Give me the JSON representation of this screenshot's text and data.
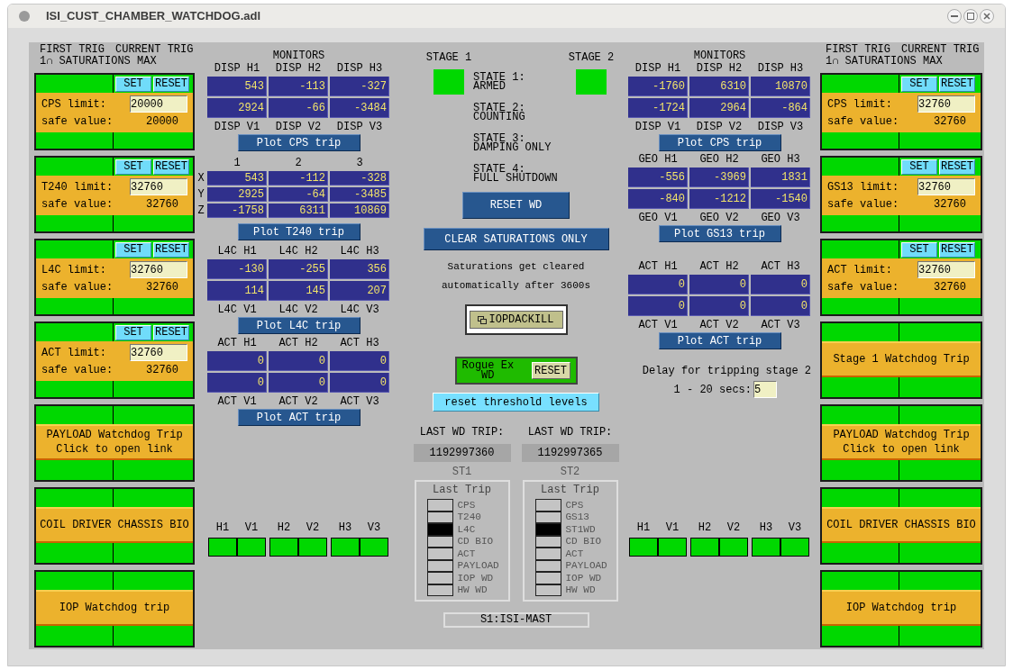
{
  "window": {
    "title": "ISI_CUST_CHAMBER_WATCHDOG.adl"
  },
  "left_column": {
    "header": [
      "FIRST TRIG",
      "CURRENT TRIG"
    ],
    "subheader": "1∩ SATURATIONS MAX",
    "cards": [
      {
        "kind": "limit",
        "label": "CPS limit:",
        "value": "20000",
        "safe_label": "safe value:",
        "safe_value": "20000",
        "set": "SET",
        "reset": "RESET"
      },
      {
        "kind": "limit",
        "label": "T240 limit:",
        "value": "32760",
        "safe_label": "safe value:",
        "safe_value": "32760",
        "set": "SET",
        "reset": "RESET"
      },
      {
        "kind": "limit",
        "label": "L4C limit:",
        "value": "32760",
        "safe_label": "safe value:",
        "safe_value": "32760",
        "set": "SET",
        "reset": "RESET"
      },
      {
        "kind": "limit",
        "label": "ACT limit:",
        "value": "32760",
        "safe_label": "safe value:",
        "safe_value": "32760",
        "set": "SET",
        "reset": "RESET"
      },
      {
        "kind": "trip",
        "lines": [
          "PAYLOAD Watchdog Trip",
          "Click to open link"
        ]
      },
      {
        "kind": "trip",
        "lines": [
          "COIL DRIVER CHASSIS BIO"
        ]
      },
      {
        "kind": "trip",
        "lines": [
          "IOP Watchdog trip"
        ]
      }
    ]
  },
  "left_monitors": {
    "title": "MONITORS",
    "groups": [
      {
        "kind": "pair",
        "top_labels": [
          "DISP H1",
          "DISP H2",
          "DISP H3"
        ],
        "rows": [
          [
            "543",
            "-113",
            "-327"
          ],
          [
            "2924",
            "-66",
            "-3484"
          ]
        ],
        "bottom_labels": [
          "DISP V1",
          "DISP V2",
          "DISP V3"
        ],
        "button": "Plot CPS trip"
      },
      {
        "kind": "matrix",
        "top_labels": [
          "1",
          "2",
          "3"
        ],
        "row_labels": [
          "X",
          "Y",
          "Z"
        ],
        "rows": [
          [
            "543",
            "-112",
            "-328"
          ],
          [
            "2925",
            "-64",
            "-3485"
          ],
          [
            "-1758",
            "6311",
            "10869"
          ]
        ],
        "button": "Plot T240 trip"
      },
      {
        "kind": "pair",
        "top_labels": [
          "L4C H1",
          "L4C H2",
          "L4C H3"
        ],
        "rows": [
          [
            "-130",
            "-255",
            "356"
          ],
          [
            "114",
            "145",
            "207"
          ]
        ],
        "bottom_labels": [
          "L4C V1",
          "L4C V2",
          "L4C V3"
        ],
        "button": "Plot L4C trip"
      },
      {
        "kind": "pair",
        "top_labels": [
          "ACT H1",
          "ACT H2",
          "ACT H3"
        ],
        "rows": [
          [
            "0",
            "0",
            "0"
          ],
          [
            "0",
            "0",
            "0"
          ]
        ],
        "bottom_labels": [
          "ACT V1",
          "ACT V2",
          "ACT V3"
        ],
        "button": "Plot ACT trip"
      }
    ],
    "indicators": [
      "H1",
      "V1",
      "H2",
      "V2",
      "H3",
      "V3"
    ]
  },
  "center": {
    "stages": [
      "STAGE 1",
      "STAGE 2"
    ],
    "states": [
      {
        "title": "STATE 1:",
        "name": "ARMED"
      },
      {
        "title": "STATE 2:",
        "name": "COUNTING"
      },
      {
        "title": "STATE 3:",
        "name": "DAMPING ONLY"
      },
      {
        "title": "STATE 4:",
        "name": "FULL SHUTDOWN"
      }
    ],
    "reset_wd": "RESET WD",
    "clear_saturations": "CLEAR SATURATIONS ONLY",
    "note": [
      "Saturations get cleared",
      "automatically after 3600s"
    ],
    "iopdackill": "IOPDACKILL",
    "rogue": {
      "label": [
        "Rogue Ex",
        "WD"
      ],
      "button": "RESET"
    },
    "reset_thresholds": "reset threshold levels",
    "last_trips": [
      {
        "label": "LAST WD TRIP:",
        "value": "1192997360",
        "stage": "ST1",
        "title": "Last Trip",
        "items": [
          {
            "label": "CPS",
            "selected": false
          },
          {
            "label": "T240",
            "selected": false
          },
          {
            "label": "L4C",
            "selected": true
          },
          {
            "label": "CD BIO",
            "selected": false
          },
          {
            "label": "ACT",
            "selected": false
          },
          {
            "label": "PAYLOAD",
            "selected": false
          },
          {
            "label": "IOP WD",
            "selected": false
          },
          {
            "label": "HW WD",
            "selected": false
          }
        ]
      },
      {
        "label": "LAST WD TRIP:",
        "value": "1192997365",
        "stage": "ST2",
        "title": "Last Trip",
        "items": [
          {
            "label": "CPS",
            "selected": false
          },
          {
            "label": "GS13",
            "selected": false
          },
          {
            "label": "ST1WD",
            "selected": true
          },
          {
            "label": "CD BIO",
            "selected": false
          },
          {
            "label": "ACT",
            "selected": false
          },
          {
            "label": "PAYLOAD",
            "selected": false
          },
          {
            "label": "IOP WD",
            "selected": false
          },
          {
            "label": "HW WD",
            "selected": false
          }
        ]
      }
    ],
    "footer": "S1:ISI-MAST"
  },
  "right_monitors": {
    "title": "MONITORS",
    "groups": [
      {
        "kind": "pair",
        "top_labels": [
          "DISP H1",
          "DISP H2",
          "DISP H3"
        ],
        "rows": [
          [
            "-1760",
            "6310",
            "10870"
          ],
          [
            "-1724",
            "2964",
            "-864"
          ]
        ],
        "bottom_labels": [
          "DISP V1",
          "DISP V2",
          "DISP V3"
        ],
        "button": "Plot CPS trip"
      },
      {
        "kind": "pair",
        "top_labels": [
          "GEO H1",
          "GEO H2",
          "GEO H3"
        ],
        "rows": [
          [
            "-556",
            "-3969",
            "1831"
          ],
          [
            "-840",
            "-1212",
            "-1540"
          ]
        ],
        "bottom_labels": [
          "GEO V1",
          "GEO V2",
          "GEO V3"
        ],
        "button": "Plot GS13 trip"
      },
      {
        "kind": "pair",
        "top_labels": [
          "ACT H1",
          "ACT H2",
          "ACT H3"
        ],
        "rows": [
          [
            "0",
            "0",
            "0"
          ],
          [
            "0",
            "0",
            "0"
          ]
        ],
        "bottom_labels": [
          "ACT V1",
          "ACT V2",
          "ACT V3"
        ],
        "button": "Plot ACT trip"
      }
    ],
    "delay": {
      "text": "Delay for tripping stage 2",
      "range": "1 - 20 secs:",
      "value": "5"
    },
    "indicators": [
      "H1",
      "V1",
      "H2",
      "V2",
      "H3",
      "V3"
    ]
  },
  "right_column": {
    "header": [
      "FIRST TRIG",
      "CURRENT TRIG"
    ],
    "subheader": "1∩ SATURATIONS MAX",
    "cards": [
      {
        "kind": "limit",
        "label": "CPS limit:",
        "value": "32760",
        "safe_label": "safe value:",
        "safe_value": "32760",
        "set": "SET",
        "reset": "RESET"
      },
      {
        "kind": "limit",
        "label": "GS13 limit:",
        "value": "32760",
        "safe_label": "safe value:",
        "safe_value": "32760",
        "set": "SET",
        "reset": "RESET"
      },
      {
        "kind": "limit",
        "label": "ACT limit:",
        "value": "32760",
        "safe_label": "safe value:",
        "safe_value": "32760",
        "set": "SET",
        "reset": "RESET"
      },
      {
        "kind": "trip",
        "lines": [
          "Stage 1 Watchdog Trip"
        ]
      },
      {
        "kind": "trip",
        "lines": [
          "PAYLOAD Watchdog Trip",
          "Click to open link"
        ]
      },
      {
        "kind": "trip",
        "lines": [
          "COIL DRIVER CHASSIS BIO"
        ]
      },
      {
        "kind": "trip",
        "lines": [
          "IOP Watchdog trip"
        ]
      }
    ]
  }
}
